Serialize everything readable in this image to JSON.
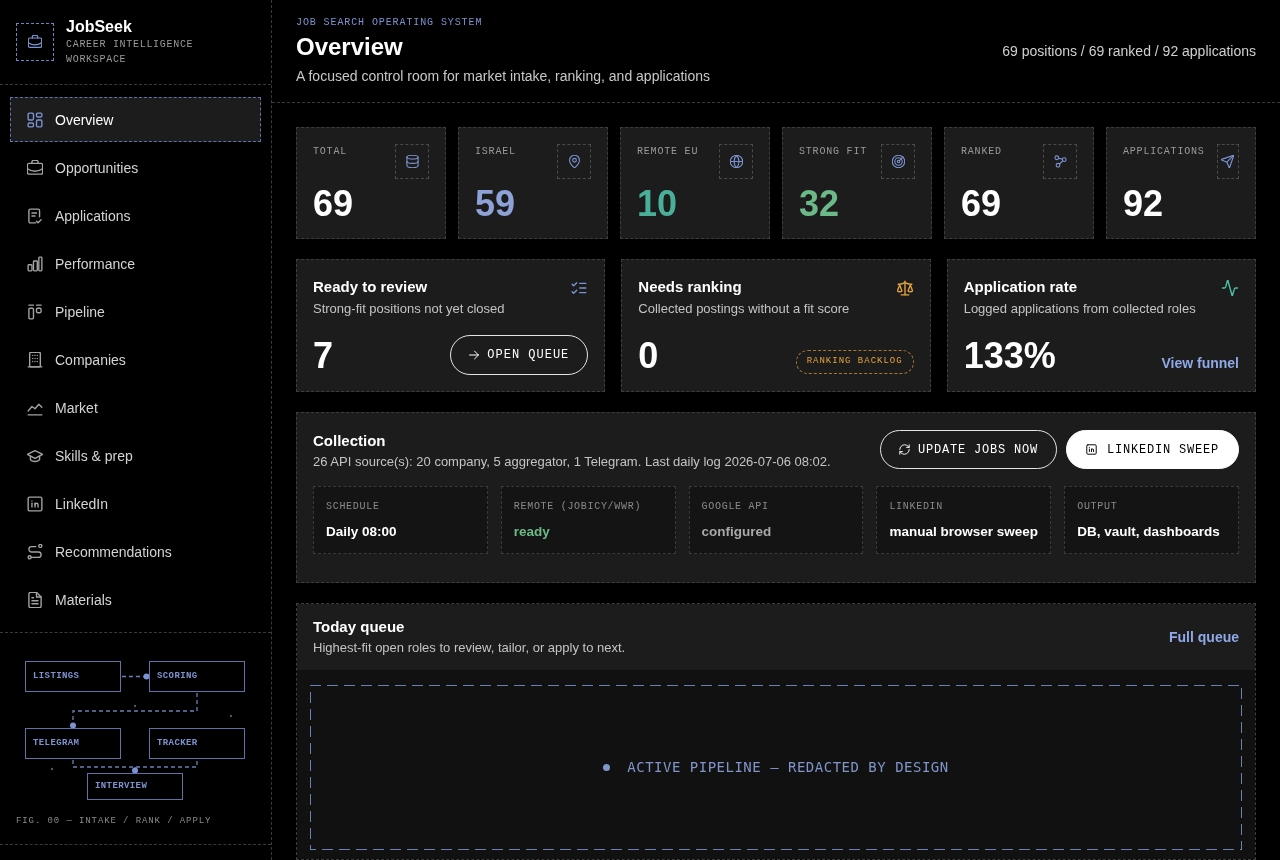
{
  "sidebar": {
    "brand": {
      "title": "JobSeek",
      "subtitle": "CAREER INTELLIGENCE WORKSPACE"
    },
    "nav": [
      {
        "label": "Overview",
        "selected": true
      },
      {
        "label": "Opportunities",
        "selected": false
      },
      {
        "label": "Applications",
        "selected": false
      },
      {
        "label": "Performance",
        "selected": false
      },
      {
        "label": "Pipeline",
        "selected": false
      },
      {
        "label": "Companies",
        "selected": false
      },
      {
        "label": "Market",
        "selected": false
      },
      {
        "label": "Skills & prep",
        "selected": false
      },
      {
        "label": "LinkedIn",
        "selected": false
      },
      {
        "label": "Recommendations",
        "selected": false
      },
      {
        "label": "Materials",
        "selected": false
      }
    ],
    "diagram": {
      "nodes": [
        "LISTINGS",
        "SCORING",
        "TELEGRAM",
        "TRACKER",
        "INTERVIEW"
      ],
      "caption": "FIG. 00 — INTAKE / RANK / APPLY"
    }
  },
  "header": {
    "eyebrow": "JOB SEARCH OPERATING SYSTEM",
    "title": "Overview",
    "subtitle": "A focused control room for market intake, ranking, and applications",
    "summary": "69 positions / 69 ranked / 92 applications"
  },
  "stats": [
    {
      "label": "TOTAL",
      "value": "69",
      "color": "#ffffff"
    },
    {
      "label": "ISRAEL",
      "value": "59",
      "color": "#8ea2d8"
    },
    {
      "label": "REMOTE EU",
      "value": "10",
      "color": "#4aaf98"
    },
    {
      "label": "STRONG FIT",
      "value": "32",
      "color": "#6ab987"
    },
    {
      "label": "RANKED",
      "value": "69",
      "color": "#ffffff"
    },
    {
      "label": "APPLICATIONS",
      "value": "92",
      "color": "#ffffff"
    }
  ],
  "highlights": [
    {
      "kind": "button",
      "title": "Ready to review",
      "description": "Strong-fit positions not yet closed",
      "value": "7",
      "action": "OPEN QUEUE"
    },
    {
      "kind": "badge",
      "title": "Needs ranking",
      "description": "Collected postings without a fit score",
      "value": "0",
      "action": "RANKING BACKLOG"
    },
    {
      "kind": "link",
      "title": "Application rate",
      "description": "Logged applications from collected roles",
      "value": "133%",
      "action": "View funnel"
    }
  ],
  "collection": {
    "title": "Collection",
    "description": "26 API source(s): 20 company, 5 aggregator, 1 Telegram. Last daily log 2026-07-06 08:02.",
    "buttons": [
      {
        "label": "UPDATE JOBS NOW",
        "kind": "outline"
      },
      {
        "label": "LINKEDIN SWEEP",
        "kind": "filled"
      }
    ],
    "fields": [
      {
        "label": "SCHEDULE",
        "value": "Daily 08:00",
        "color": "#ffffff"
      },
      {
        "label": "REMOTE (JOBICY/WWR)",
        "value": "ready",
        "color": "#6ab987"
      },
      {
        "label": "GOOGLE API",
        "value": "configured",
        "color": "#a8a8a8"
      },
      {
        "label": "LINKEDIN",
        "value": "manual browser sweep",
        "color": "#ffffff"
      },
      {
        "label": "OUTPUT",
        "value": "DB, vault, dashboards",
        "color": "#ffffff"
      }
    ]
  },
  "queue": {
    "title": "Today queue",
    "description": "Highest-fit open roles to review, tailor, or apply to next.",
    "link": "Full queue",
    "notice": "ACTIVE PIPELINE — REDACTED BY DESIGN"
  }
}
